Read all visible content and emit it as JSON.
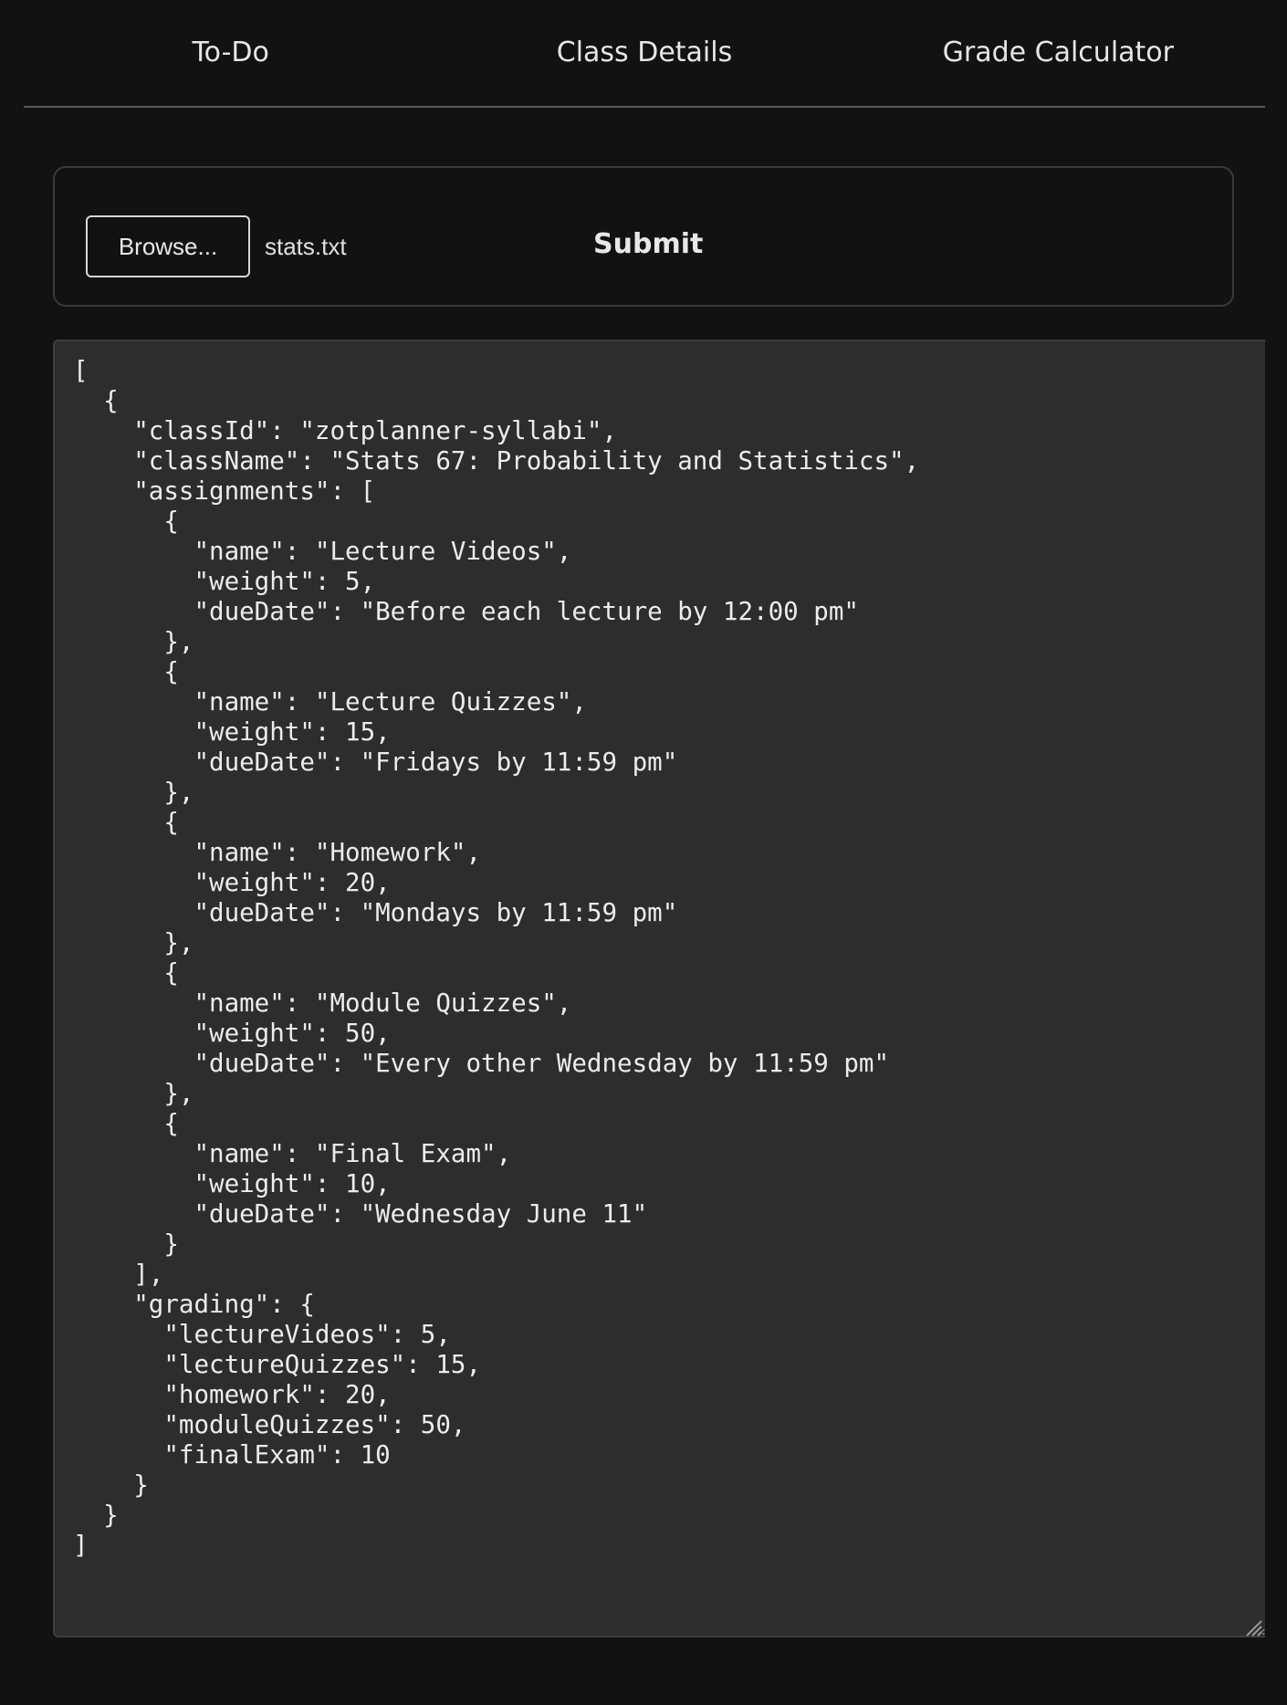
{
  "nav": {
    "tabs": [
      {
        "label": "To-Do"
      },
      {
        "label": "Class Details"
      },
      {
        "label": "Grade Calculator"
      }
    ]
  },
  "upload": {
    "browse_label": "Browse...",
    "file_name": "stats.txt",
    "submit_label": "Submit"
  },
  "editor": {
    "content": "[\n  {\n    \"classId\": \"zotplanner-syllabi\",\n    \"className\": \"Stats 67: Probability and Statistics\",\n    \"assignments\": [\n      {\n        \"name\": \"Lecture Videos\",\n        \"weight\": 5,\n        \"dueDate\": \"Before each lecture by 12:00 pm\"\n      },\n      {\n        \"name\": \"Lecture Quizzes\",\n        \"weight\": 15,\n        \"dueDate\": \"Fridays by 11:59 pm\"\n      },\n      {\n        \"name\": \"Homework\",\n        \"weight\": 20,\n        \"dueDate\": \"Mondays by 11:59 pm\"\n      },\n      {\n        \"name\": \"Module Quizzes\",\n        \"weight\": 50,\n        \"dueDate\": \"Every other Wednesday by 11:59 pm\"\n      },\n      {\n        \"name\": \"Final Exam\",\n        \"weight\": 10,\n        \"dueDate\": \"Wednesday June 11\"\n      }\n    ],\n    \"grading\": {\n      \"lectureVideos\": 5,\n      \"lectureQuizzes\": 15,\n      \"homework\": 20,\n      \"moduleQuizzes\": 50,\n      \"finalExam\": 10\n    }\n  }\n]"
  },
  "colors": {
    "background": "#121212",
    "editor_background": "#2d2d2d",
    "text": "#e8e8e8",
    "divider": "#5a5a5a"
  }
}
